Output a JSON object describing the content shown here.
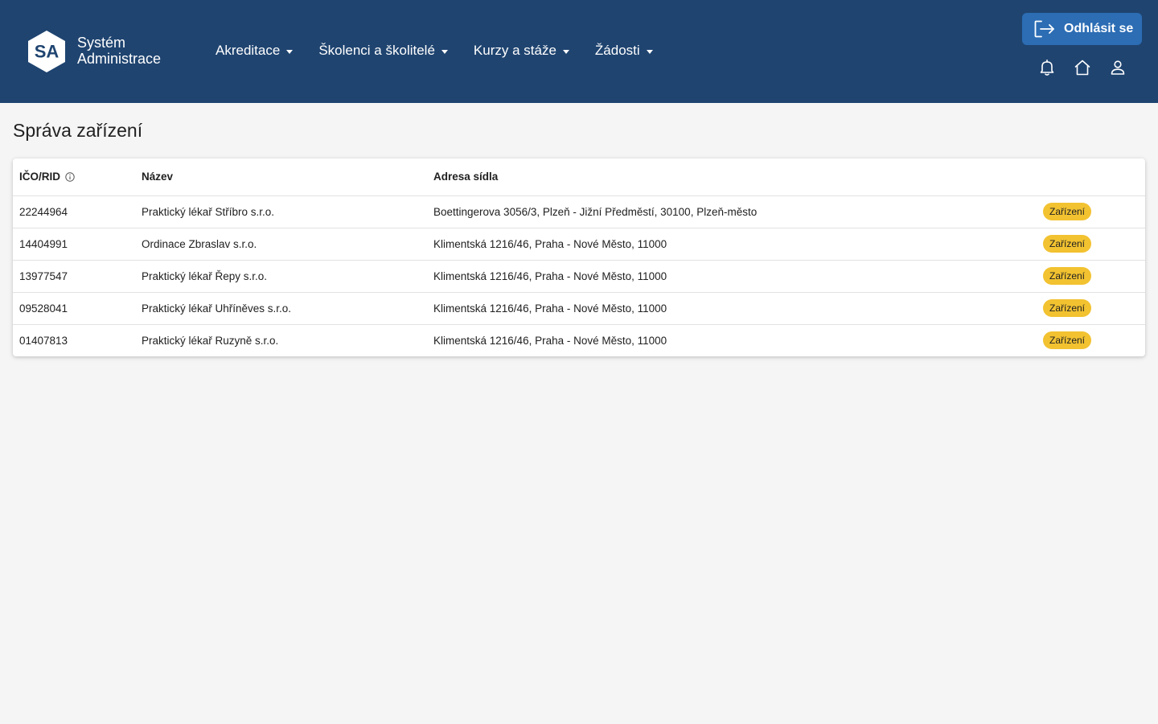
{
  "header": {
    "logo_text": "SA",
    "brand_line1": "Systém",
    "brand_line2": "Administrace",
    "nav": [
      {
        "label": "Akreditace"
      },
      {
        "label": "Školenci a školitelé"
      },
      {
        "label": "Kurzy a stáže"
      },
      {
        "label": "Žádosti"
      }
    ],
    "logout_label": "Odhlásit se",
    "icons": [
      "bell-icon",
      "home-icon",
      "user-icon"
    ]
  },
  "page": {
    "title": "Správa zařízení"
  },
  "table": {
    "columns": [
      "IČO/RID",
      "Název",
      "Adresa sídla"
    ],
    "rows": [
      {
        "ico": "22244964",
        "name": "Praktický lékař Stříbro s.r.o.",
        "address": "Boettingerova 3056/3, Plzeň - Jižní Předměstí, 30100, Plzeň-město",
        "badge": "Zařízení"
      },
      {
        "ico": "14404991",
        "name": "Ordinace Zbraslav s.r.o.",
        "address": "Klimentská 1216/46, Praha - Nové Město, 11000",
        "badge": "Zařízení"
      },
      {
        "ico": "13977547",
        "name": "Praktický lékař Řepy s.r.o.",
        "address": "Klimentská 1216/46, Praha - Nové Město, 11000",
        "badge": "Zařízení"
      },
      {
        "ico": "09528041",
        "name": "Praktický lékař Uhříněves s.r.o.",
        "address": "Klimentská 1216/46, Praha - Nové Město, 11000",
        "badge": "Zařízení"
      },
      {
        "ico": "01407813",
        "name": "Praktický lékař Ruzyně s.r.o.",
        "address": "Klimentská 1216/46, Praha - Nové Město, 11000",
        "badge": "Zařízení"
      }
    ]
  },
  "colors": {
    "header_bg": "#1f4470",
    "button_bg": "#2c6db4",
    "badge_bg": "#f2c230",
    "page_bg": "#f5f5f5"
  }
}
